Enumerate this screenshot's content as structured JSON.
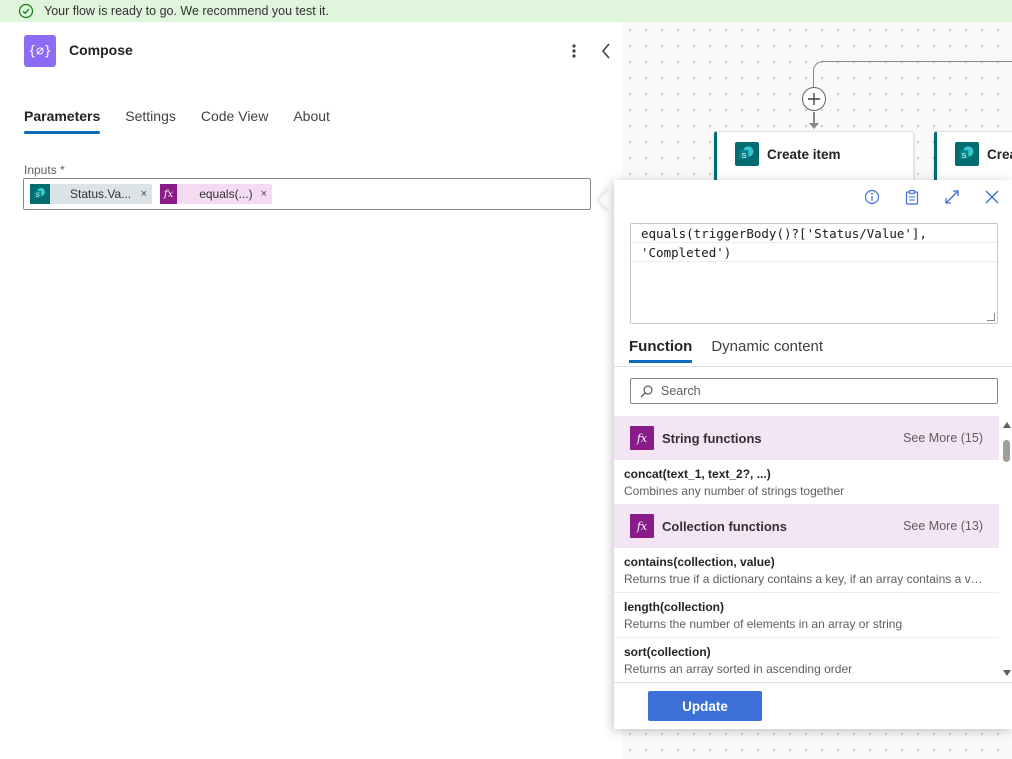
{
  "banner": {
    "message": "Your flow is ready to go. We recommend you test it.",
    "icon": "check-circle-icon",
    "color": "#dff6dd"
  },
  "panel": {
    "title": "Compose",
    "icon_text": "{⌀}",
    "icon_color": "#8c6cf4",
    "tabs": [
      {
        "label": "Parameters",
        "active": true
      },
      {
        "label": "Settings",
        "active": false
      },
      {
        "label": "Code View",
        "active": false
      },
      {
        "label": "About",
        "active": false
      }
    ],
    "inputs_label": "Inputs *",
    "tokens": [
      {
        "label": "Status.Va...",
        "type": "sharepoint",
        "close": "×"
      },
      {
        "label": "equals(...)",
        "type": "expression",
        "close": "×"
      }
    ]
  },
  "canvas": {
    "cards": [
      {
        "title": "Create item",
        "icon_text": "S"
      },
      {
        "title": "Create item",
        "icon_text": "S"
      }
    ]
  },
  "expression_popup": {
    "expression_lines": [
      "equals(triggerBody()?['Status/Value'],",
      "'Completed')"
    ],
    "tabs": [
      {
        "label": "Function",
        "active": true
      },
      {
        "label": "Dynamic content",
        "active": false
      }
    ],
    "search": {
      "placeholder": "Search",
      "value": ""
    },
    "categories": [
      {
        "name": "String functions",
        "see_more": "See More (15)",
        "functions": [
          {
            "name": "concat(text_1, text_2?, ...)",
            "description": "Combines any number of strings together"
          }
        ]
      },
      {
        "name": "Collection functions",
        "see_more": "See More (13)",
        "functions": [
          {
            "name": "contains(collection, value)",
            "description": "Returns true if a dictionary contains a key, if an array contains a val..."
          },
          {
            "name": "length(collection)",
            "description": "Returns the number of elements in an array or string"
          },
          {
            "name": "sort(collection)",
            "description": "Returns an array sorted in ascending order"
          }
        ]
      }
    ],
    "update_label": "Update"
  }
}
